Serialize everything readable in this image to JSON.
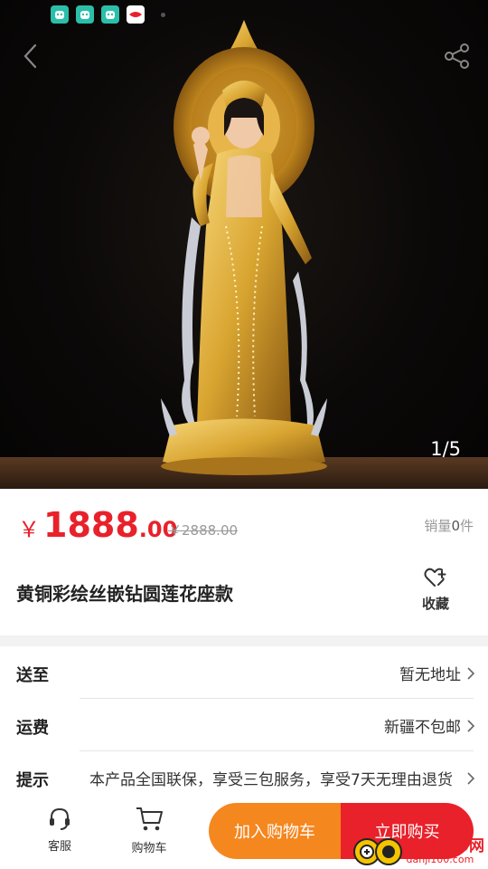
{
  "gallery": {
    "counter": "1/5"
  },
  "product": {
    "currency": "￥",
    "price_int": "1888",
    "price_dec": ".00",
    "original_price": "￥2888.00",
    "sales_prefix": "销量",
    "sales_count": "0",
    "sales_suffix": "件",
    "title": "黄铜彩绘丝嵌钻圆莲花座款",
    "favorite_label": "收藏"
  },
  "info": {
    "ship_to_label": "送至",
    "ship_to_value": "暂无地址",
    "freight_label": "运费",
    "freight_value": "新疆不包邮",
    "tip_label": "提示",
    "tip_value": "本产品全国联保，享受三包服务，享受7天无理由退货"
  },
  "bottom": {
    "service_label": "客服",
    "cart_label": "购物车",
    "add_to_cart": "加入购物车",
    "buy_now": "立即购买"
  },
  "watermark": {
    "text": "单机100网",
    "sub": "danji100.com"
  },
  "colors": {
    "accent_red": "#e8212b",
    "accent_orange": "#f5871f"
  }
}
